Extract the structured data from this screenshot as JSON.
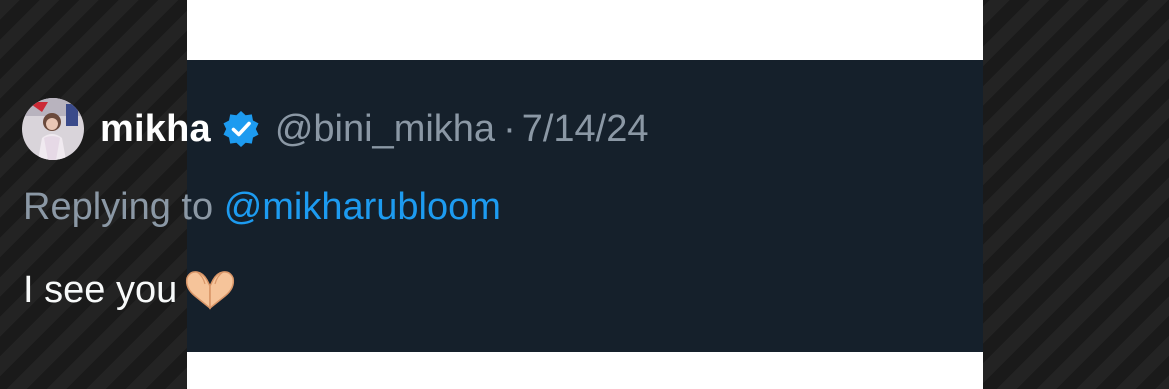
{
  "tweet": {
    "display_name": "mikha",
    "handle": "@bini_mikha",
    "separator": "·",
    "date": "7/14/24",
    "replying_prefix": "Replying to",
    "replying_to": "@mikharubloom",
    "text": "I see you",
    "emoji_icon": "heart-hands-icon",
    "verified_icon": "verified-badge-icon"
  },
  "colors": {
    "tweet_background": "#15202b",
    "name_text": "#ffffff",
    "muted_text": "#8b98a5",
    "mention": "#1d9bf0",
    "verified_badge": "#1d9bf0"
  }
}
